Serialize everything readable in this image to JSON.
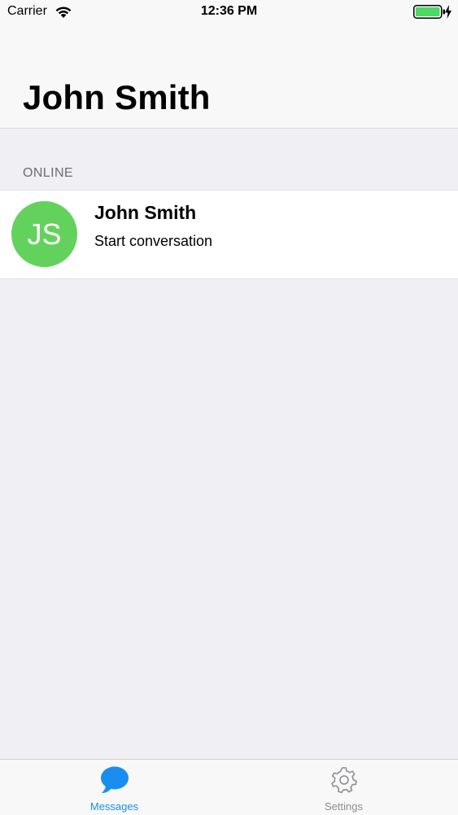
{
  "status_bar": {
    "carrier": "Carrier",
    "time": "12:36 PM",
    "wifi_icon": "wifi-icon",
    "battery_icon": "battery-full-icon",
    "charging_icon": "charging-bolt-icon",
    "battery_color": "#4cd964"
  },
  "header": {
    "title": "John Smith"
  },
  "section": {
    "label": "ONLINE"
  },
  "contacts": [
    {
      "initials": "JS",
      "name": "John Smith",
      "subtitle": "Start conversation",
      "avatar_color": "#63d25c"
    }
  ],
  "tabs": [
    {
      "label": "Messages",
      "icon": "chat-bubble-icon",
      "active": true,
      "color": "#1a8df0"
    },
    {
      "label": "Settings",
      "icon": "gear-icon",
      "active": false,
      "color": "#8e8e93"
    }
  ]
}
